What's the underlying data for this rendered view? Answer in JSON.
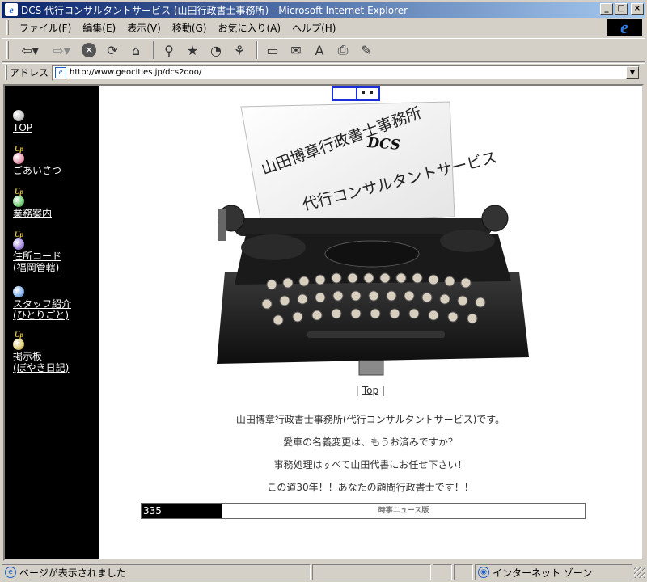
{
  "window": {
    "title": "DCS 代行コンサルタントサービス (山田行政書士事務所) - Microsoft Internet Explorer",
    "app_icon": "ie-page-icon",
    "controls": {
      "minimize": "_",
      "maximize": "□",
      "close": "×"
    }
  },
  "menu": {
    "items": [
      "ファイル(F)",
      "編集(E)",
      "表示(V)",
      "移動(G)",
      "お気に入り(A)",
      "ヘルプ(H)"
    ],
    "logo": "e"
  },
  "toolbar": {
    "buttons": [
      "back-icon",
      "forward-icon",
      "stop-icon",
      "refresh-icon",
      "home-icon",
      "search-icon",
      "favorites-icon",
      "history-icon",
      "channels-icon",
      "fullscreen-icon",
      "mail-icon",
      "font-icon",
      "print-icon",
      "edit-icon"
    ]
  },
  "address": {
    "label": "アドレス",
    "url": "http://www.geocities.jp/dcs2ooo/"
  },
  "sidebar": {
    "up_badge": "Up",
    "items": [
      {
        "label": "TOP",
        "label2": "",
        "ball_color": "#c8c8c8",
        "up": false
      },
      {
        "label": "ごあいさつ",
        "label2": "",
        "ball_color": "#e8a0b4",
        "up": true
      },
      {
        "label": "業務案内",
        "label2": "",
        "ball_color": "#7cd07c",
        "up": true
      },
      {
        "label": "住所コード",
        "label2": "(福岡管轄)",
        "ball_color": "#a890e0",
        "up": true
      },
      {
        "label": "スタッフ紹介",
        "label2": "(ひとりごと)",
        "ball_color": "#8cb8ec",
        "up": false
      },
      {
        "label": "掲示板",
        "label2": "(ぼやき日記)",
        "ball_color": "#e0d080",
        "up": true
      }
    ]
  },
  "hero": {
    "line1": "山田博章行政書士事務所",
    "line2": "DCS",
    "line3": "代行コンサルタントサービス"
  },
  "main": {
    "top_link": "Top",
    "paragraphs": [
      "山田博章行政書士事務所(代行コンサルタントサービス)です。",
      "愛車の名義変更は、もうお済みですか？",
      "事務処理はすべて山田代書にお任せ下さい！",
      "この道30年！！あなたの顧問行政書士です！！"
    ],
    "counter": "335",
    "news_label": "時事ニュース版"
  },
  "status": {
    "text": "ページが表示されました",
    "zone": "インターネット ゾーン"
  }
}
